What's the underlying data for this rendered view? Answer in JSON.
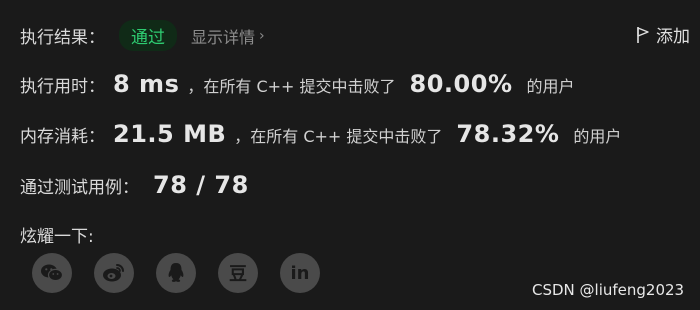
{
  "result": {
    "label": "执行结果：",
    "status": "通过",
    "details_link": "显示详情",
    "details_chevron": "›",
    "add_note": "添加",
    "colors": {
      "status_text": "#2ecc71",
      "status_bg": "#102a17"
    }
  },
  "runtime": {
    "label": "执行用时：",
    "value": "8 ms",
    "mid_text": "，在所有 C++ 提交中击败了",
    "percent": "80.00%",
    "suffix": "的用户"
  },
  "memory": {
    "label": "内存消耗：",
    "value": "21.5 MB",
    "mid_text": "，在所有 C++ 提交中击败了",
    "percent": "78.32%",
    "suffix": "的用户"
  },
  "tests": {
    "label": "通过测试用例：",
    "value": "78 / 78"
  },
  "share": {
    "label": "炫耀一下:",
    "buttons": [
      {
        "icon": "wechat-icon"
      },
      {
        "icon": "weibo-icon"
      },
      {
        "icon": "qq-icon"
      },
      {
        "icon": "douban-icon",
        "glyph": "豆"
      },
      {
        "icon": "linkedin-icon",
        "glyph": "in"
      }
    ]
  },
  "watermark": "CSDN @liufeng2023"
}
